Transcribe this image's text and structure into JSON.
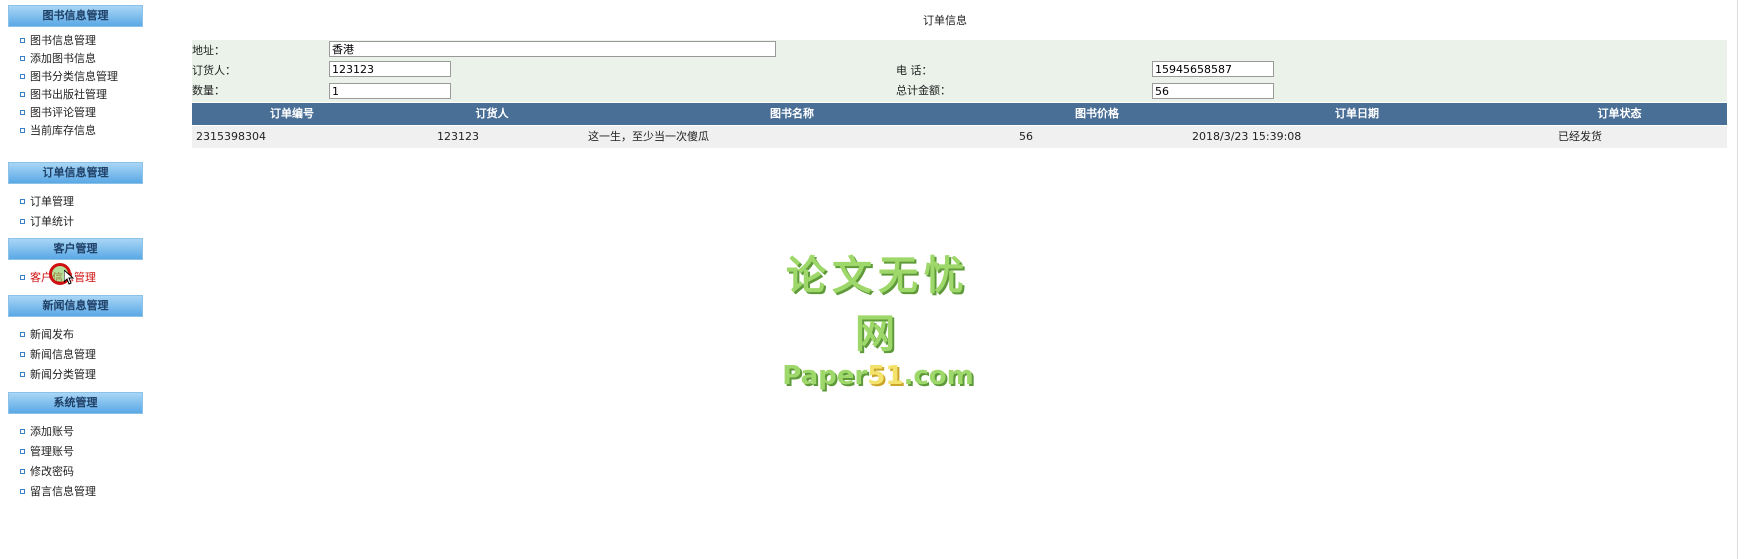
{
  "sidebar": {
    "sections": [
      {
        "title": "图书信息管理",
        "items": [
          "图书信息管理",
          "添加图书信息",
          "图书分类信息管理",
          "图书出版社管理",
          "图书评论管理",
          "当前库存信息"
        ]
      },
      {
        "title": "订单信息管理",
        "items": [
          "订单管理",
          "订单统计"
        ]
      },
      {
        "title": "客户管理",
        "items": [
          "客户信息管理"
        ]
      },
      {
        "title": "新闻信息管理",
        "items": [
          "新闻发布",
          "新闻信息管理",
          "新闻分类管理"
        ]
      },
      {
        "title": "系统管理",
        "items": [
          "添加账号",
          "管理账号",
          "修改密码",
          "留言信息管理"
        ]
      }
    ],
    "active_item": "客户信息管理"
  },
  "page": {
    "title": "订单信息"
  },
  "form": {
    "address_label": "地址：",
    "address_value": "香港",
    "orderer_label": "订货人：",
    "orderer_value": "123123",
    "phone_label": "电 话：",
    "phone_value": "15945658587",
    "qty_label": "数量：",
    "qty_value": "1",
    "total_label": "总计金额：",
    "total_value": "56"
  },
  "table": {
    "columns": [
      "订单编号",
      "订货人",
      "图书名称",
      "图书价格",
      "订单日期",
      "订单状态"
    ],
    "rows": [
      [
        "2315398304",
        "123123",
        "这一生，至少当一次傻瓜",
        "56",
        "2018/3/23 15:39:08",
        "已经发货"
      ]
    ]
  },
  "watermark": {
    "cn": "论文无忧网",
    "en_prefix": "Paper",
    "en_num": "51",
    "en_suffix": ".com"
  },
  "colors": {
    "table_header": "#4a6f97",
    "form_bg": "#eaf2ea",
    "sidebar_head": "#5aa8e6",
    "active_link": "#d01010"
  }
}
